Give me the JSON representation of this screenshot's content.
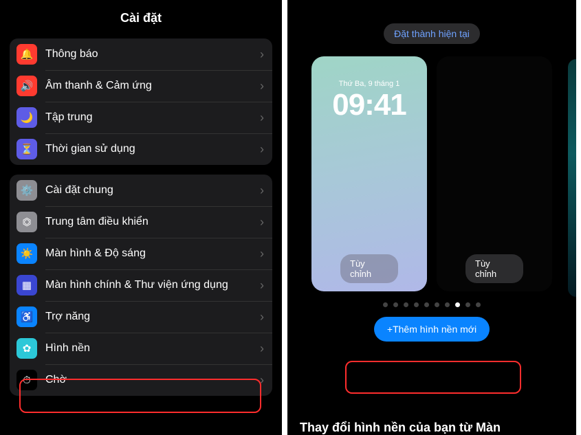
{
  "left": {
    "title": "Cài đặt",
    "group1": [
      {
        "label": "Thông báo",
        "icon": "bell",
        "bg": "#ff3b30"
      },
      {
        "label": "Âm thanh & Cảm ứng",
        "icon": "sound",
        "bg": "#ff3b30"
      },
      {
        "label": "Tập trung",
        "icon": "moon",
        "bg": "#5e5ce6"
      },
      {
        "label": "Thời gian sử dụng",
        "icon": "hourglass",
        "bg": "#5e5ce6"
      }
    ],
    "group2": [
      {
        "label": "Cài đặt chung",
        "icon": "gear",
        "bg": "#8e8e93"
      },
      {
        "label": "Trung tâm điều khiển",
        "icon": "switches",
        "bg": "#8e8e93"
      },
      {
        "label": "Màn hình & Độ sáng",
        "icon": "brightness",
        "bg": "#0a84ff"
      },
      {
        "label": "Màn hình chính & Thư viện ứng dụng",
        "icon": "grid",
        "bg": "#3a46d1"
      },
      {
        "label": "Trợ năng",
        "icon": "accessibility",
        "bg": "#0a84ff"
      },
      {
        "label": "Hình nền",
        "icon": "wallpaper",
        "bg": "#2cc8d8"
      },
      {
        "label": "Chờ",
        "icon": "standby",
        "bg": "#000"
      }
    ]
  },
  "right": {
    "set_current": "Đặt thành hiện tại",
    "lockscreen": {
      "date": "Thứ Ba, 9 tháng 1",
      "time": "09:41",
      "customize": "Tùy chỉnh"
    },
    "homescreen": {
      "customize": "Tùy chỉnh"
    },
    "pager": {
      "count": 10,
      "active": 7
    },
    "add_button": "+Thêm hình nền mới",
    "footer": "Thay đổi hình nền của bạn từ Màn"
  },
  "icons": {
    "bell": "🔔",
    "sound": "🔊",
    "moon": "🌙",
    "hourglass": "⏳",
    "gear": "⚙️",
    "switches": "⏣",
    "brightness": "☀️",
    "grid": "▦",
    "accessibility": "♿",
    "wallpaper": "✿",
    "standby": "⏱"
  }
}
